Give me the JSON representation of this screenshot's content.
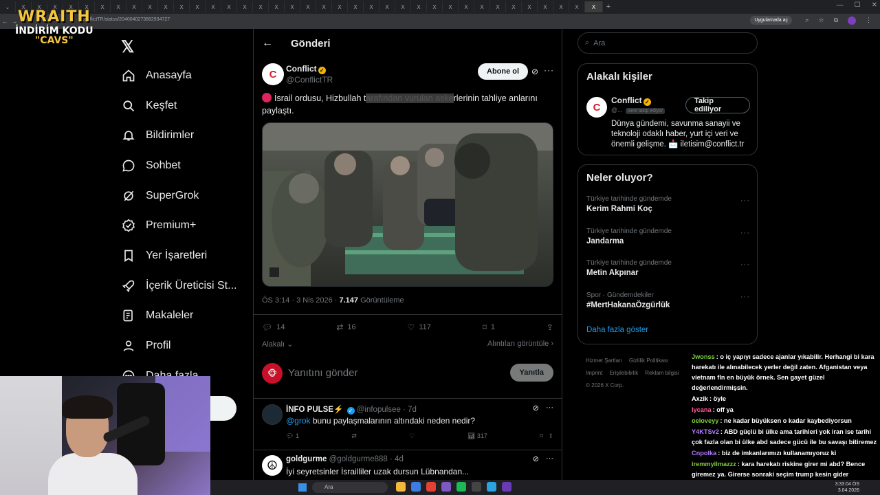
{
  "browser": {
    "tab_count": 37,
    "tab_glyph": "X",
    "url": "/ConflictTR/status/2040040273862934727",
    "app_pill": "Uygulamada aç"
  },
  "overlay": {
    "brand": "WRAITH",
    "discount_line": "İNDİRİM KODU",
    "code": "\"CAVS\""
  },
  "sidebar": {
    "items": [
      {
        "label": "Anasayfa",
        "icon": "home-icon"
      },
      {
        "label": "Keşfet",
        "icon": "search-icon"
      },
      {
        "label": "Bildirimler",
        "icon": "bell-icon"
      },
      {
        "label": "Sohbet",
        "icon": "chat-icon"
      },
      {
        "label": "SuperGrok",
        "icon": "grok-icon"
      },
      {
        "label": "Premium+",
        "icon": "verified-icon"
      },
      {
        "label": "Yer İşaretleri",
        "icon": "bookmark-icon"
      },
      {
        "label": "İçerik Üreticisi St...",
        "icon": "rocket-icon"
      },
      {
        "label": "Makaleler",
        "icon": "article-icon"
      },
      {
        "label": "Profil",
        "icon": "person-icon"
      },
      {
        "label": "Daha fazla",
        "icon": "more-circle-icon"
      }
    ]
  },
  "main": {
    "header_title": "Gönderi",
    "post": {
      "author_name": "Conflict",
      "author_handle": "@ConflictTR",
      "subscribe_label": "Abone ol",
      "text_before": "İsrail ordusu, Hizbullah t",
      "text_highlight": "arafından vurulan aske",
      "text_after": "rlerinin tahliye anlarını paylaştı.",
      "time": "ÖS 3:14 · 3 Nis 2026 · ",
      "views": "7.147",
      "views_label": " Görüntüleme",
      "replies": "14",
      "reposts": "16",
      "likes": "117",
      "bookmarks": "1",
      "sort_label": "Alakalı",
      "quotes_label": "Alıntıları görüntüle"
    },
    "reply_box": {
      "placeholder": "Yanıtını gönder",
      "button": "Yanıtla"
    },
    "replies": [
      {
        "name": "İNFO PULSE⚡",
        "handle": "@infopulsee · 7d",
        "mention": "@grok",
        "text": " bunu paylaşmalarının altındaki neden nedir?",
        "reply_count": "1",
        "views": "317"
      },
      {
        "name": "goldgurme",
        "handle": "@goldgurme888 · 4d",
        "mention": "",
        "text": "İyi seyretsinler İsrailliler uzak dursun Lübnandan..."
      }
    ]
  },
  "right": {
    "search_placeholder": "Ara",
    "relevant_title": "Alakalı kişiler",
    "person": {
      "name": "Conflict",
      "handle": "@...",
      "follows_you": "Seni takip ediyor",
      "follow_label": "Takip ediliyor",
      "bio": "Dünya gündemi, savunma sanayii ve teknoloji odaklı haber, yurt içi veri ve önemli gelişme. 📩 iletisim@conflict.tr"
    },
    "trends_title": "Neler oluyor?",
    "trends": [
      {
        "category": "Türkiye tarihinde gündemde",
        "name": "Kerim Rahmi Koç"
      },
      {
        "category": "Türkiye tarihinde gündemde",
        "name": "Jandarma"
      },
      {
        "category": "Türkiye tarihinde gündemde",
        "name": "Metin Akpınar"
      },
      {
        "category": "Spor · Gündemdekiler",
        "name": "#MertHakanaÖzgürlük"
      }
    ],
    "show_more": "Daha fazla göster",
    "footer": [
      "Hizmet Şartları",
      "Gizlilik Politikası",
      "Imprint",
      "Erişilebilirlik",
      "Reklam bilgisi",
      "© 2026 X Corp."
    ]
  },
  "chat": [
    {
      "user": "Jwonss",
      "color": "#7fd13b",
      "text": "o iç yapıyı sadece ajanlar yıkabilir. Herhangi bi kara harekatı ile alınabilecek yerler değil zaten. Afganistan veya vietnam fln en büyük örnek. Sen gayet güzel değerlendirmişsin."
    },
    {
      "user": "Axzik",
      "color": "#ffffff",
      "text": "öyle"
    },
    {
      "user": "lycana",
      "color": "#ff5fa0",
      "text": "off ya"
    },
    {
      "user": "oeloveyy",
      "color": "#7fd13b",
      "text": "ne kadar büyüksen o kadar kaybediyorsun"
    },
    {
      "user": "Y4KTSv2",
      "color": "#b57cff",
      "text": "ABD güçlü bi ülke ama tarihleri yok iran ise tarihi çok fazla olan bi ülke abd sadece gücü ile bu savaşı bitiremez"
    },
    {
      "user": "Cnpolka",
      "color": "#b57cff",
      "text": "biz de imkanlarımızı kullanamıyoruz ki"
    },
    {
      "user": "iremmyilmazzz",
      "color": "#7fd13b",
      "text": "kara harekatı riskine girer mi abd? Bence giremez ya. Girerse sonraki seçim trump kesin gider demokratlar gelir başa @cavs"
    }
  ],
  "taskbar": {
    "search": "Ara",
    "time": "3:33:04 ÖS",
    "date": "3.04.2026"
  },
  "colors": {
    "accent": "#1d9bf0",
    "background": "#000000",
    "border": "#2f3336",
    "muted": "#71767b",
    "gold_badge": "#f4b400"
  }
}
